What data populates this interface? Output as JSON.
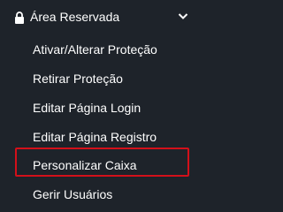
{
  "header": {
    "label": "Área Reservada",
    "lock_icon": "lock-icon",
    "chevron_icon": "chevron-down-icon"
  },
  "items": [
    {
      "label": "Ativar/Alterar Proteção"
    },
    {
      "label": "Retirar Proteção"
    },
    {
      "label": "Editar Página Login"
    },
    {
      "label": "Editar Página Registro"
    },
    {
      "label": "Personalizar Caixa",
      "highlighted": true
    },
    {
      "label": "Gerir Usuários"
    }
  ],
  "colors": {
    "background": "#1e232a",
    "text": "#ffffff",
    "highlight": "#d3101a"
  }
}
